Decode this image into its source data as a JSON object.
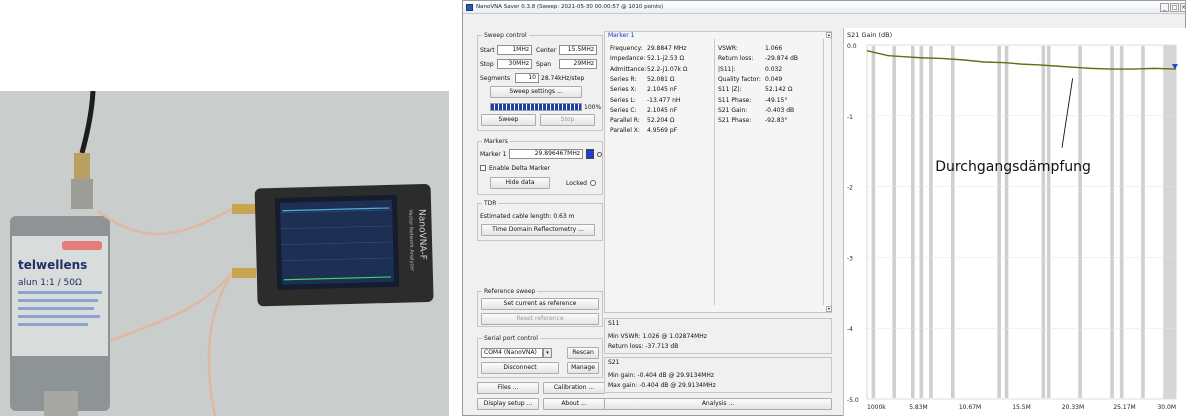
{
  "window": {
    "title": "NanoVNA Saver 0.3.8 (Sweep: 2021-05-30 00:00:57 @ 1010 points)"
  },
  "photo": {
    "device_label": "NanoVNA-F",
    "device_sublabel": "Vector Network Analyzer",
    "balun_label_line1": "telwellens",
    "balun_label_line2": "alun 1:1 / 50Ω"
  },
  "sweep_control": {
    "title": "Sweep control",
    "start_label": "Start",
    "start_value": "1MHz",
    "center_label": "Center",
    "center_value": "15.5MHz",
    "stop_label": "Stop",
    "stop_value": "30MHz",
    "span_label": "Span",
    "span_value": "29MHz",
    "segments_label": "Segments",
    "segments_value": "10",
    "step_text": "28.74kHz/step",
    "settings_button": "Sweep settings ...",
    "progress": 100,
    "progress_text": "100%",
    "sweep_button": "Sweep",
    "stop_button": "Stop"
  },
  "markers": {
    "title": "Markers",
    "marker1_label": "Marker 1",
    "marker1_value": "29.896467MHz",
    "marker1_color": "#1b3fd0",
    "delta_label": "Enable Delta Marker",
    "hide_button": "Hide data",
    "locked_label": "Locked"
  },
  "tdr": {
    "title": "TDR",
    "cable_length": "Estimated cable length: 0.63 m",
    "tdr_button": "Time Domain Reflectometry ..."
  },
  "reference": {
    "title": "Reference sweep",
    "set_button": "Set current as reference",
    "reset_button": "Reset reference"
  },
  "serial": {
    "title": "Serial port control",
    "port_value": "COM4 (NanoVNA)",
    "rescan_button": "Rescan",
    "disconnect_button": "Disconnect",
    "manage_button": "Manage"
  },
  "bottom": {
    "files_button": "Files ...",
    "calibration_button": "Calibration ...",
    "display_button": "Display setup ...",
    "about_button": "About ...",
    "analysis_button": "Analysis ..."
  },
  "marker1": {
    "title": "Marker 1",
    "left": [
      {
        "label": "Frequency:",
        "value": "29.8847 MHz"
      },
      {
        "label": "Impedance:",
        "value": "52.1-j2.53 Ω"
      },
      {
        "label": "Admittance:",
        "value": "52.2-j1.07k Ω"
      },
      {
        "label": "Series R:",
        "value": "52.081 Ω"
      },
      {
        "label": "Series X:",
        "value": "2.1045 nF"
      },
      {
        "label": "Series L:",
        "value": "-13.477 nH"
      },
      {
        "label": "Series C:",
        "value": "2.1045 nF"
      },
      {
        "label": "Parallel R:",
        "value": "52.204 Ω"
      },
      {
        "label": "Parallel X:",
        "value": "4.9569 pF"
      }
    ],
    "right": [
      {
        "label": "VSWR:",
        "value": "1.066"
      },
      {
        "label": "Return loss:",
        "value": "-29.874 dB"
      },
      {
        "label": "|S11|:",
        "value": "0.032"
      },
      {
        "label": "Quality factor:",
        "value": "0.049"
      },
      {
        "label": "S11 |Z|:",
        "value": "52.142 Ω"
      },
      {
        "label": "S11 Phase:",
        "value": "-49.15°"
      },
      {
        "label": "S21 Gain:",
        "value": "-0.403 dB"
      },
      {
        "label": "S21 Phase:",
        "value": "-92.83°"
      }
    ]
  },
  "s11": {
    "title": "S11",
    "min_vswr": "Min VSWR:  1.026 @ 1.02874MHz",
    "return_loss": "Return loss:  -37.713 dB"
  },
  "s21": {
    "title": "S21",
    "min_gain": "Min gain:  -0.404 dB @ 29.9134MHz",
    "max_gain": "Max gain:  -0.404 dB @ 29.9134MHz"
  },
  "chart_data": {
    "type": "line",
    "title": "S21 Gain (dB)",
    "ylim": [
      -5.0,
      0.0
    ],
    "yticks": [
      "0.0",
      "-1",
      "-2",
      "-3",
      "-4",
      "-5.0"
    ],
    "xticks": [
      "1000k",
      "5.83M",
      "10.67M",
      "15.5M",
      "20.33M",
      "25.17M",
      "30.0M"
    ],
    "x_mhz": [
      1.0,
      3.0,
      5.0,
      6.0,
      8.0,
      10.0,
      12.0,
      14.0,
      15.5,
      17.0,
      19.0,
      21.0,
      22.0,
      24.0,
      26.0,
      28.0,
      30.0
    ],
    "values": [
      -0.08,
      -0.15,
      -0.17,
      -0.18,
      -0.19,
      -0.21,
      -0.24,
      -0.25,
      -0.27,
      -0.28,
      -0.3,
      -0.32,
      -0.33,
      -0.34,
      -0.34,
      -0.33,
      -0.34
    ],
    "series_color": "#6b6b15",
    "marker_color": "#1b3fd0",
    "annotation": "Durchgangsdämpfung"
  }
}
